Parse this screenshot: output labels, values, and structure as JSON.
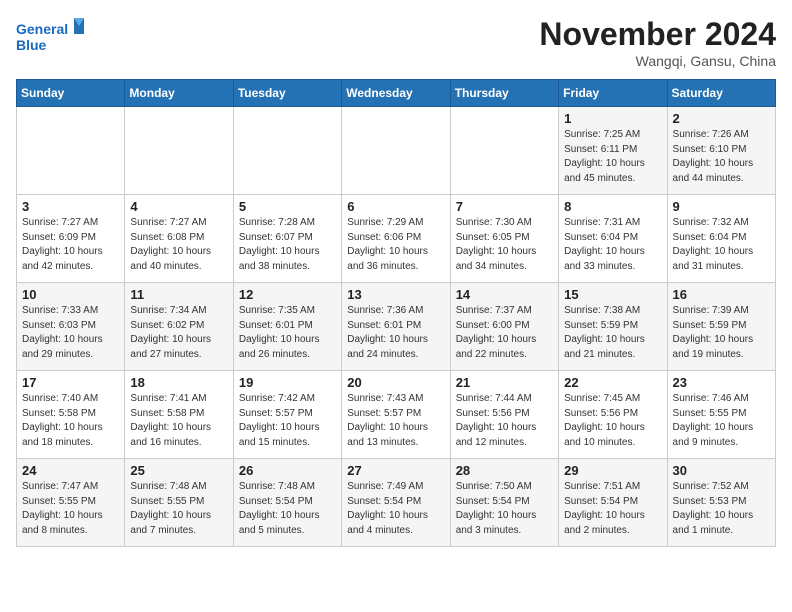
{
  "header": {
    "logo_line1": "General",
    "logo_line2": "Blue",
    "month": "November 2024",
    "location": "Wangqi, Gansu, China"
  },
  "weekdays": [
    "Sunday",
    "Monday",
    "Tuesday",
    "Wednesday",
    "Thursday",
    "Friday",
    "Saturday"
  ],
  "weeks": [
    [
      {
        "day": "",
        "info": ""
      },
      {
        "day": "",
        "info": ""
      },
      {
        "day": "",
        "info": ""
      },
      {
        "day": "",
        "info": ""
      },
      {
        "day": "",
        "info": ""
      },
      {
        "day": "1",
        "info": "Sunrise: 7:25 AM\nSunset: 6:11 PM\nDaylight: 10 hours\nand 45 minutes."
      },
      {
        "day": "2",
        "info": "Sunrise: 7:26 AM\nSunset: 6:10 PM\nDaylight: 10 hours\nand 44 minutes."
      }
    ],
    [
      {
        "day": "3",
        "info": "Sunrise: 7:27 AM\nSunset: 6:09 PM\nDaylight: 10 hours\nand 42 minutes."
      },
      {
        "day": "4",
        "info": "Sunrise: 7:27 AM\nSunset: 6:08 PM\nDaylight: 10 hours\nand 40 minutes."
      },
      {
        "day": "5",
        "info": "Sunrise: 7:28 AM\nSunset: 6:07 PM\nDaylight: 10 hours\nand 38 minutes."
      },
      {
        "day": "6",
        "info": "Sunrise: 7:29 AM\nSunset: 6:06 PM\nDaylight: 10 hours\nand 36 minutes."
      },
      {
        "day": "7",
        "info": "Sunrise: 7:30 AM\nSunset: 6:05 PM\nDaylight: 10 hours\nand 34 minutes."
      },
      {
        "day": "8",
        "info": "Sunrise: 7:31 AM\nSunset: 6:04 PM\nDaylight: 10 hours\nand 33 minutes."
      },
      {
        "day": "9",
        "info": "Sunrise: 7:32 AM\nSunset: 6:04 PM\nDaylight: 10 hours\nand 31 minutes."
      }
    ],
    [
      {
        "day": "10",
        "info": "Sunrise: 7:33 AM\nSunset: 6:03 PM\nDaylight: 10 hours\nand 29 minutes."
      },
      {
        "day": "11",
        "info": "Sunrise: 7:34 AM\nSunset: 6:02 PM\nDaylight: 10 hours\nand 27 minutes."
      },
      {
        "day": "12",
        "info": "Sunrise: 7:35 AM\nSunset: 6:01 PM\nDaylight: 10 hours\nand 26 minutes."
      },
      {
        "day": "13",
        "info": "Sunrise: 7:36 AM\nSunset: 6:01 PM\nDaylight: 10 hours\nand 24 minutes."
      },
      {
        "day": "14",
        "info": "Sunrise: 7:37 AM\nSunset: 6:00 PM\nDaylight: 10 hours\nand 22 minutes."
      },
      {
        "day": "15",
        "info": "Sunrise: 7:38 AM\nSunset: 5:59 PM\nDaylight: 10 hours\nand 21 minutes."
      },
      {
        "day": "16",
        "info": "Sunrise: 7:39 AM\nSunset: 5:59 PM\nDaylight: 10 hours\nand 19 minutes."
      }
    ],
    [
      {
        "day": "17",
        "info": "Sunrise: 7:40 AM\nSunset: 5:58 PM\nDaylight: 10 hours\nand 18 minutes."
      },
      {
        "day": "18",
        "info": "Sunrise: 7:41 AM\nSunset: 5:58 PM\nDaylight: 10 hours\nand 16 minutes."
      },
      {
        "day": "19",
        "info": "Sunrise: 7:42 AM\nSunset: 5:57 PM\nDaylight: 10 hours\nand 15 minutes."
      },
      {
        "day": "20",
        "info": "Sunrise: 7:43 AM\nSunset: 5:57 PM\nDaylight: 10 hours\nand 13 minutes."
      },
      {
        "day": "21",
        "info": "Sunrise: 7:44 AM\nSunset: 5:56 PM\nDaylight: 10 hours\nand 12 minutes."
      },
      {
        "day": "22",
        "info": "Sunrise: 7:45 AM\nSunset: 5:56 PM\nDaylight: 10 hours\nand 10 minutes."
      },
      {
        "day": "23",
        "info": "Sunrise: 7:46 AM\nSunset: 5:55 PM\nDaylight: 10 hours\nand 9 minutes."
      }
    ],
    [
      {
        "day": "24",
        "info": "Sunrise: 7:47 AM\nSunset: 5:55 PM\nDaylight: 10 hours\nand 8 minutes."
      },
      {
        "day": "25",
        "info": "Sunrise: 7:48 AM\nSunset: 5:55 PM\nDaylight: 10 hours\nand 7 minutes."
      },
      {
        "day": "26",
        "info": "Sunrise: 7:48 AM\nSunset: 5:54 PM\nDaylight: 10 hours\nand 5 minutes."
      },
      {
        "day": "27",
        "info": "Sunrise: 7:49 AM\nSunset: 5:54 PM\nDaylight: 10 hours\nand 4 minutes."
      },
      {
        "day": "28",
        "info": "Sunrise: 7:50 AM\nSunset: 5:54 PM\nDaylight: 10 hours\nand 3 minutes."
      },
      {
        "day": "29",
        "info": "Sunrise: 7:51 AM\nSunset: 5:54 PM\nDaylight: 10 hours\nand 2 minutes."
      },
      {
        "day": "30",
        "info": "Sunrise: 7:52 AM\nSunset: 5:53 PM\nDaylight: 10 hours\nand 1 minute."
      }
    ]
  ]
}
